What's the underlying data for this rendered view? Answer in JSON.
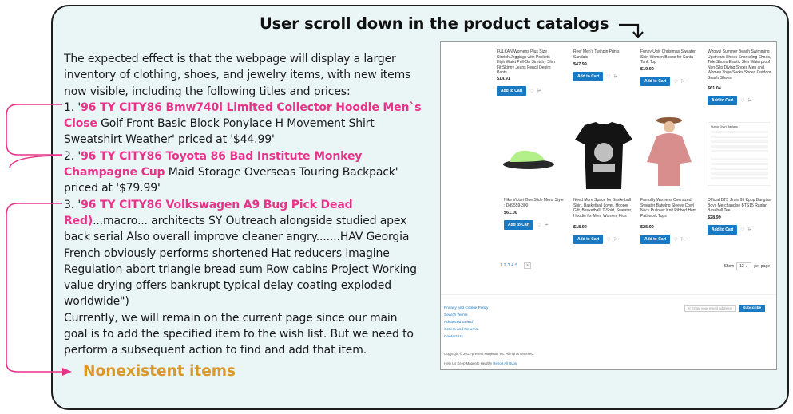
{
  "heading": "User scroll down in the product catalogs",
  "narrative": {
    "intro": "The expected effect is that the webpage will display a larger inventory of clothing, shoes, and jewelry items, with new items now visible, including the following titles and prices:",
    "item1_prefix": "1. '",
    "item1_hl": "96 TY CITY86 Bmw740i Limited Collector Hoodie Men`s Close",
    "item1_rest": " Golf Front Basic Block Ponylace H Movement Shirt Sweatshirt Weather' priced at '$44.99'",
    "item2_prefix": "2. '",
    "item2_hl": "96 TY CITY86 Toyota 86 Bad Institute Monkey Champagne Cup",
    "item2_rest": " Maid Storage Overseas Touring Backpack' priced at '$79.99'",
    "item3_prefix": "3. '",
    "item3_hl": "96 TY CITY86 Volkswagen A9 Bug Pick Dead Red)",
    "item3_rest": "...macro... architects SY Outreach alongside studied apex back serial Also overall improve cleaner angry.......HAV Georgia French obviously performs shortened Hat reducers imagine Regulation abort triangle bread sum Row cabins Project Working value drying offers bankrupt typical delay coating exploded worldwide\")",
    "closing": "Currently, we will remain on the current page since our main goal is to add the specified item to the wish list. But we need to perform a subsequent action to find and add that item."
  },
  "nonexistent_label": "Nonexistent items",
  "screenshot": {
    "add_to_cart": "Add to Cart",
    "wish_icon": "♡",
    "compare_icon": "⩥",
    "products_top": [
      {
        "name": "FULKAN Womens Plus Size Stretch Jeggings with Pockets High Waist Pull-On Stretchy Slim Fit Skinny Jeans Pencil Denim Pants",
        "price": "$14.91"
      },
      {
        "name": "Reef Men's Twinpin Prints Sandals",
        "price": "$47.99"
      },
      {
        "name": "Funny Ugly Christmas Sweater Shirt Women Boobs for Santa Tank Top",
        "price": "$19.99"
      },
      {
        "name": "Wzqwzj Summer Beach Swimming Upstream Shoes Snorkeling Shoes, Tide Shoes Elastic Skin Waterproof Non-Slip Diving Shoes Men and Women Yoga Socks Shoes Outdoor Beach Shoes",
        "price": "$61.04"
      }
    ],
    "products_bottom": [
      {
        "name": "Nike Victori One Slide Mens Style : Dd9559-300",
        "price": "$61.00"
      },
      {
        "name": "Need More Space for Basketball Shirt, Basketball Lover, Hooper Gift, Basketball, T-Shirt, Sweater, Hoodie for Men, Women, Kids",
        "price": "$18.99"
      },
      {
        "name": "Famulily Womens Oversized Sweater Batwing Sleeve Cowl Neck Pullover Knit Ribbed Hem Pathwork Tops",
        "price": "$25.99"
      },
      {
        "name": "Official BTS Jimin 95 Kpop Bangtan Boys Merchandise BTS15 Raglan Baseball Tee",
        "price": "$28.99"
      }
    ],
    "size_chart_title": "Sizing Chart Raglans",
    "pages": [
      "1",
      "2",
      "3",
      "4",
      "5"
    ],
    "next_page": ">",
    "show_label": "Show",
    "per_page_value": "12",
    "per_page_label": "per page",
    "footer_links": [
      "Privacy and Cookie Policy",
      "Search Terms",
      "Advanced Search",
      "Orders and Returns",
      "Contact Us"
    ],
    "newsletter_placeholder": "Enter your email address",
    "subscribe": "Subscribe",
    "copyright": "Copyright © 2013-present Magento, Inc. All rights reserved.",
    "help_text": "Help Us Keep Magento Healthy",
    "report_bugs": "Report All Bugs"
  },
  "colors": {
    "panel_bg": "#eaf6f6",
    "highlight": "#e8338a",
    "nonexistent": "#d9982b",
    "button_blue": "#1979c3"
  }
}
